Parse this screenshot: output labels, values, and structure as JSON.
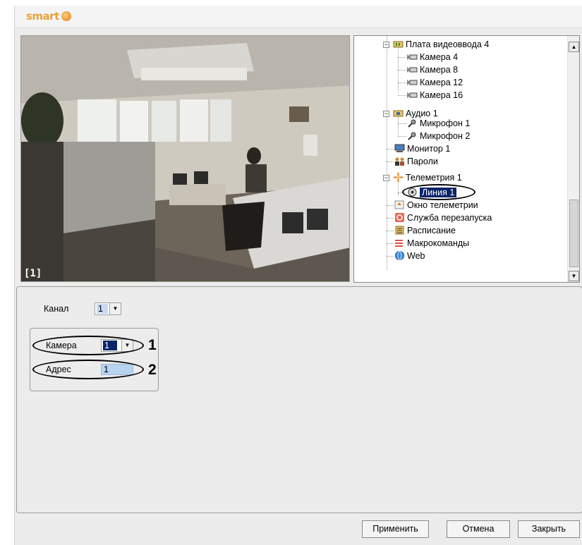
{
  "app": {
    "logo_text": "smart"
  },
  "video": {
    "channel_label": "[1]"
  },
  "tree": {
    "items": [
      {
        "label": "Плата видеоввода 4",
        "icon": "capture-board-icon"
      },
      {
        "label": "Камера 4",
        "icon": "camera-icon"
      },
      {
        "label": "Камера 8",
        "icon": "camera-icon"
      },
      {
        "label": "Камера 12",
        "icon": "camera-icon"
      },
      {
        "label": "Камера 16",
        "icon": "camera-icon"
      },
      {
        "label": "Аудио 1",
        "icon": "audio-board-icon"
      },
      {
        "label": "Микрофон 1",
        "icon": "microphone-icon"
      },
      {
        "label": "Микрофон 2",
        "icon": "microphone-icon"
      },
      {
        "label": "Монитор 1",
        "icon": "monitor-icon"
      },
      {
        "label": "Пароли",
        "icon": "users-icon"
      },
      {
        "label": "Телеметрия 1",
        "icon": "telemetry-icon"
      },
      {
        "label": "Линия 1",
        "icon": "ptz-line-icon",
        "selected": true
      },
      {
        "label": "Окно телеметрии",
        "icon": "telemetry-window-icon"
      },
      {
        "label": "Служба перезапуска",
        "icon": "restart-service-icon"
      },
      {
        "label": "Расписание",
        "icon": "schedule-icon"
      },
      {
        "label": "Макрокоманды",
        "icon": "macro-icon"
      },
      {
        "label": "Web",
        "icon": "web-icon"
      }
    ]
  },
  "settings": {
    "channel_label": "Канал",
    "channel_value": "1",
    "camera_label": "Камера",
    "camera_value": "1",
    "address_label": "Адрес",
    "address_value": "1",
    "callout_1": "1",
    "callout_2": "2"
  },
  "buttons": {
    "apply": "Применить",
    "cancel": "Отмена",
    "close": "Закрыть"
  },
  "colors": {
    "selection": "#0a246a",
    "address_field": "#b7d3f0",
    "logo": "#e8a23a"
  }
}
